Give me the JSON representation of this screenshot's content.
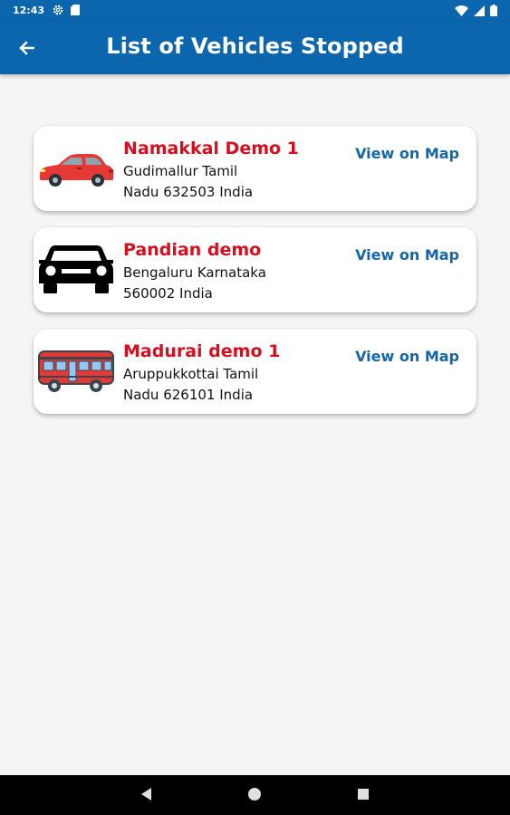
{
  "status_bar": {
    "time": "12:43",
    "left_icons": [
      "settings-icon",
      "sd-card-icon"
    ],
    "right_icons": [
      "wifi-icon",
      "signal-icon",
      "battery-icon"
    ]
  },
  "app_bar": {
    "title": "List of Vehicles Stopped",
    "back_icon": "arrow-left-icon",
    "background": "#0b66ad"
  },
  "vehicles": [
    {
      "name": "Namakkal Demo 1",
      "address_line1": "Gudimallur Tamil",
      "address_line2": "Nadu 632503 India",
      "action": "View on Map",
      "icon": "car-red-icon"
    },
    {
      "name": "Pandian demo",
      "address_line1": "Bengaluru Karnataka",
      "address_line2": "560002 India",
      "action": "View on Map",
      "icon": "car-black-icon"
    },
    {
      "name": "Madurai demo 1",
      "address_line1": "Aruppukkottai Tamil",
      "address_line2": "Nadu 626101 India",
      "action": "View on Map",
      "icon": "bus-red-icon"
    }
  ],
  "nav_bar": {
    "buttons": [
      "back-triangle-icon",
      "home-circle-icon",
      "recents-square-icon"
    ]
  },
  "colors": {
    "name_red": "#d50f1e",
    "link_blue": "#1565a8",
    "page_background": "#f5f5f5"
  }
}
